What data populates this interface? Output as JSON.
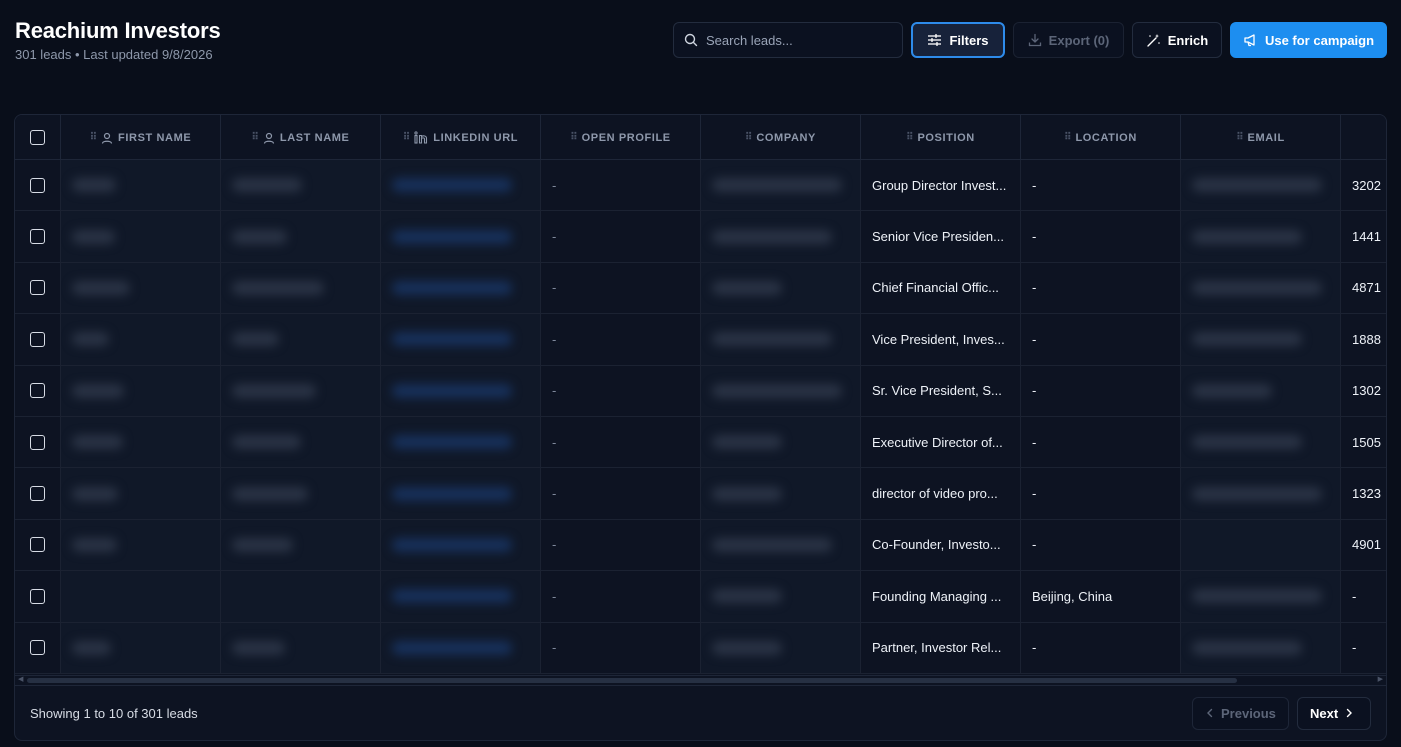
{
  "header": {
    "title": "Reachium Investors",
    "subtitle": "301 leads • Last updated 9/8/2026"
  },
  "toolbar": {
    "search_placeholder": "Search leads...",
    "filters_label": "Filters",
    "export_label": "Export (0)",
    "enrich_label": "Enrich",
    "campaign_label": "Use for campaign"
  },
  "table": {
    "columns": [
      "FIRST NAME",
      "LAST NAME",
      "LINKEDIN URL",
      "OPEN PROFILE",
      "COMPANY",
      "POSITION",
      "LOCATION",
      "EMAIL"
    ],
    "rows": [
      {
        "open_profile": "-",
        "position": "Group Director Invest...",
        "location": "-",
        "extra": "3202"
      },
      {
        "open_profile": "-",
        "position": "Senior Vice Presiden...",
        "location": "-",
        "extra": "1441"
      },
      {
        "open_profile": "-",
        "position": "Chief Financial Offic...",
        "location": "-",
        "extra": "4871"
      },
      {
        "open_profile": "-",
        "position": "Vice President, Inves...",
        "location": "-",
        "extra": "1888"
      },
      {
        "open_profile": "-",
        "position": "Sr. Vice President, S...",
        "location": "-",
        "extra": "1302"
      },
      {
        "open_profile": "-",
        "position": "Executive Director of...",
        "location": "-",
        "extra": "1505"
      },
      {
        "open_profile": "-",
        "position": "director of video pro...",
        "location": "-",
        "extra": "1323"
      },
      {
        "open_profile": "-",
        "position": "Co-Founder, Investo...",
        "location": "-",
        "extra": "4901"
      },
      {
        "open_profile": "-",
        "position": "Founding Managing ...",
        "location": "Beijing, China",
        "extra": "-"
      },
      {
        "open_profile": "-",
        "position": "Partner, Investor Rel...",
        "location": "-",
        "extra": "-"
      }
    ]
  },
  "footer": {
    "showing": "Showing 1 to 10 of 301 leads",
    "previous_label": "Previous",
    "next_label": "Next"
  },
  "colors": {
    "background": "#090e1a",
    "accent": "#1d8ef0",
    "filters_border": "#2e8bea"
  }
}
